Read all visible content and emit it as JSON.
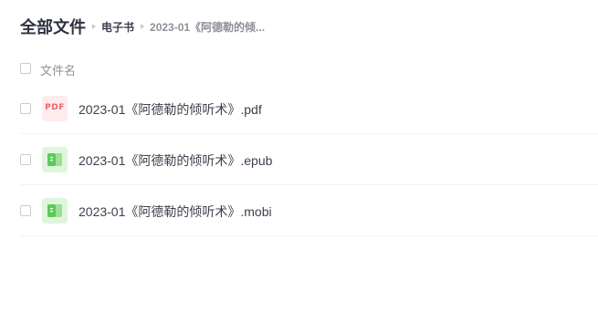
{
  "breadcrumb": {
    "root": "全部文件",
    "parent": "电子书",
    "current": "2023-01《阿德勒的倾..."
  },
  "list_header": {
    "name_column": "文件名"
  },
  "files": [
    {
      "name": "2023-01《阿德勒的倾听术》.pdf",
      "icon": "pdf-file-icon"
    },
    {
      "name": "2023-01《阿德勒的倾听术》.epub",
      "icon": "ebook-file-icon"
    },
    {
      "name": "2023-01《阿德勒的倾听术》.mobi",
      "icon": "ebook-file-icon"
    }
  ],
  "icons": {
    "pdf_label": "PDF"
  },
  "colors": {
    "pdf_icon_bg": "#fdecec",
    "pdf_icon_text": "#f0616a",
    "ebook_icon_bg": "#dff5dc",
    "ebook_icon_fg": "#5cc95a"
  }
}
